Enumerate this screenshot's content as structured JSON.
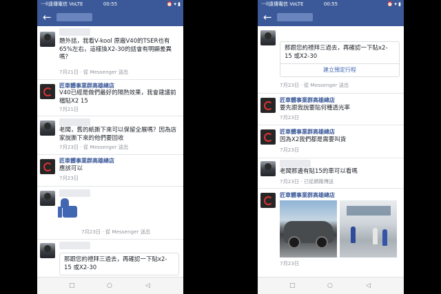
{
  "statusbar": {
    "carrier": "᠁ll遠傳電信 VoLTE",
    "time": "00:55",
    "sysicons": "⏰ ▾ ▮"
  },
  "left": {
    "messages": [
      {
        "text": "題外話，我看V-kool 原廠V40的TSER也有65%左右，這樣換X2-30的話會有明顯差異嗎？",
        "meta": "7月21日 · 從 Messenger 送出"
      },
      {
        "sender": "匠車體事業群高雄總店",
        "text": "V40已經是做們最好的隔熱效果，我會建議前檔貼X2 15",
        "meta": "7月21日"
      },
      {
        "text": "老闆，舊的紙撕下來可以保留全展嗎？因為店家說撕下來的他們要回收",
        "meta": "7月23日 · 從 Messenger 送出"
      },
      {
        "sender": "匠車體事業群高雄總店",
        "text": "應該可以",
        "meta": "7月23日"
      },
      {
        "meta": "7月23日 · 從 Messenger 送出"
      },
      {
        "card_text": "那跟您約禮拜三過去，再確認一下貼x2-15 或X2-30"
      }
    ]
  },
  "right": {
    "messages": [
      {
        "card_text": "那跟您約禮拜三過去，再確認一下貼x2-15 或X2-30",
        "card_button": "建立預定行程",
        "meta": "7月23日 · 從 Messenger 送出"
      },
      {
        "sender": "匠車體事業群高雄總店",
        "text": "要先跟我說要貼何種透光率",
        "meta": "7月23日"
      },
      {
        "sender": "匠車體事業群高雄總店",
        "text": "因為X2我們都是需要叫貨",
        "meta": "7月23日"
      },
      {
        "text": "老闆那邊有貼15的車可以看嗎",
        "meta": "7月23日 · 已從網路傳送"
      },
      {
        "sender": "匠車體事業群高雄總店",
        "meta": "7月23日"
      }
    ]
  },
  "navbar": {
    "back": "←"
  },
  "bottom_nav": {
    "square": "□",
    "circle": "○",
    "triangle": "◁"
  },
  "colors": {
    "facebook_blue": "#3b5998",
    "like_blue": "#4267b2"
  }
}
